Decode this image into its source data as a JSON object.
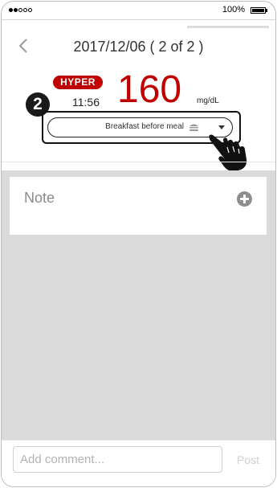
{
  "status_bar": {
    "signal_bars_filled": 2,
    "signal_bars_total": 5,
    "battery_text": "100%",
    "battery_level": 1.0
  },
  "load_progress": 0.3,
  "nav": {
    "back_icon": "chevron-left-icon",
    "title": "2017/12/06 ( 2 of 2 )"
  },
  "reading": {
    "status_badge": "HYPER",
    "time": "11:56",
    "value": "160",
    "unit": "mg/dL",
    "meal_tag": "Breakfast before meal",
    "meal_icon": "burger-icon",
    "step_number": "2",
    "pointer_icon": "pointing-hand-icon"
  },
  "note": {
    "title": "Note",
    "add_icon": "plus-circle-icon"
  },
  "comment": {
    "placeholder": "Add comment...",
    "post_label": "Post"
  },
  "colors": {
    "accent_red": "#c00000",
    "background_gray": "#dadada",
    "muted_text": "#8a8a8a"
  }
}
